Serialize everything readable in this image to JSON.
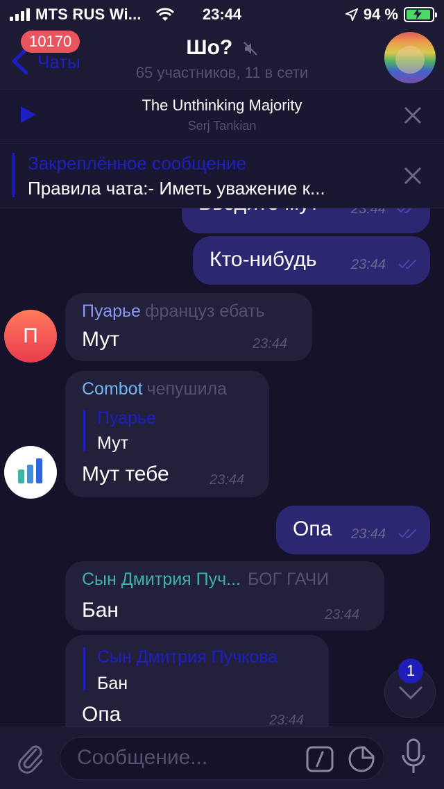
{
  "status": {
    "carrier": "MTS RUS Wi...",
    "time": "23:44",
    "battery": "94 %"
  },
  "nav": {
    "back_label": "Чаты",
    "badge": "10170",
    "title": "Шо?",
    "subtitle": "65 участников, 11 в сети"
  },
  "player": {
    "title": "The Unthinking Majority",
    "artist": "Serj Tankian"
  },
  "pinned": {
    "label": "Закреплённое сообщение",
    "text": "Правила чата:-  Иметь уважение к..."
  },
  "messages": {
    "m1": {
      "text": "Введите мут",
      "time": "23:44"
    },
    "m2": {
      "text": "Кто-нибудь",
      "time": "23:44"
    },
    "m3": {
      "sender": "Пуарье",
      "role": "француз ебать",
      "text": "Мут",
      "time": "23:44",
      "avatar_letter": "П"
    },
    "m4": {
      "sender": "Combot",
      "role": "чепушила",
      "reply_name": "Пуарье",
      "reply_text": "Мут",
      "text": "Мут тебе",
      "time": "23:44"
    },
    "m5": {
      "text": "Опа",
      "time": "23:44"
    },
    "m6": {
      "sender": "Сын Дмитрия Пуч...",
      "role": "БОГ ГАЧИ",
      "text": "Бан",
      "time": "23:44"
    },
    "m7": {
      "reply_name": "Сын Дмитрия Пучкова",
      "reply_text": "Бан",
      "text": "Опа",
      "time": "23:44"
    }
  },
  "unread_count": "1",
  "input": {
    "placeholder": "Сообщение..."
  },
  "colors": {
    "accent": "#1d1ec4",
    "outgoing": "#2b2770",
    "incoming": "#22203a",
    "poirier": "#8a96f2",
    "combot": "#6fb8f2",
    "son": "#3fb2a6"
  }
}
